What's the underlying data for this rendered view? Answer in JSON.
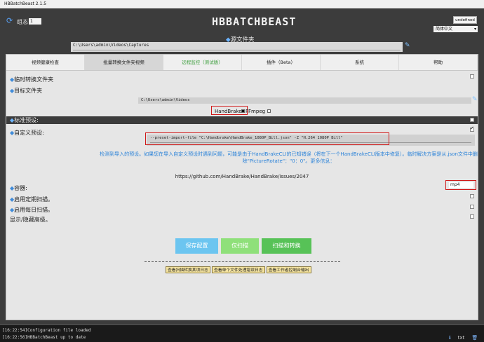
{
  "window": {
    "title": "HBBatchBeast 2.1.5"
  },
  "header": {
    "group_label": "组态",
    "group_value": "1",
    "logo": "HBBATCHBEAST",
    "undefined_button": "undefined",
    "language": "简体中文"
  },
  "source": {
    "label": "源文件夹",
    "path": "C:\\Users\\admin\\Videos\\Captures"
  },
  "tabs": [
    {
      "label": "视频健康检查"
    },
    {
      "label": "批量转换文件夹视频"
    },
    {
      "label": "远程监控（测试版）"
    },
    {
      "label": "插件（Beta）"
    },
    {
      "label": "系统"
    },
    {
      "label": "帮助"
    }
  ],
  "settings": {
    "temp_folder_label": "临时转换文件夹",
    "target_folder_label": "目标文件夹",
    "target_path": "C:\\Users\\admin\\Videos",
    "handbrake_label": "HandBrake",
    "ffmpeg_label": "FFmpeg",
    "standard_preset_label": "标准预设:",
    "custom_preset_label": "自定义预设:",
    "custom_preset_value": "--preset-import-file \"C:\\Handbrake\\HandBrake_1080P_Bill.json\" -Z \"H.264 1080P Bill\"",
    "warning_text": "检测到导入的预设。如果您在导入自定义预设时遇到问题，可能是由于HandBrakeCLI的已知错误（将在下一个HandBrakeCLI版本中修复）。临时解决方案是从.json文件中删除\"PictureRotate\"：\"0：0\"。更多信息：",
    "issue_url": "https://github.com/HandBrake/HandBrake/issues/2047",
    "container_label": "容器:",
    "container_value": "mp4",
    "scheduled_scan_label": "启用定期扫描。",
    "daily_scan_label": "启用每日扫描。",
    "show_advanced_label": "显示/隐藏高级。"
  },
  "actions": {
    "save": "保存配置",
    "scan": "仅扫描",
    "scan_convert": "扫描和转换"
  },
  "log_links": [
    "查看扫描转换某项日志",
    "查看单个文件处理错误日志",
    "查看工作者控制台输出"
  ],
  "console": {
    "lines": [
      "[16:22:54]Configuration file loaded",
      "[16:22:56]HBBatchBeast up to date"
    ],
    "tools": {
      "info_icon": "info-icon",
      "txt_label": "txt",
      "trash_icon": "trash-icon"
    }
  }
}
